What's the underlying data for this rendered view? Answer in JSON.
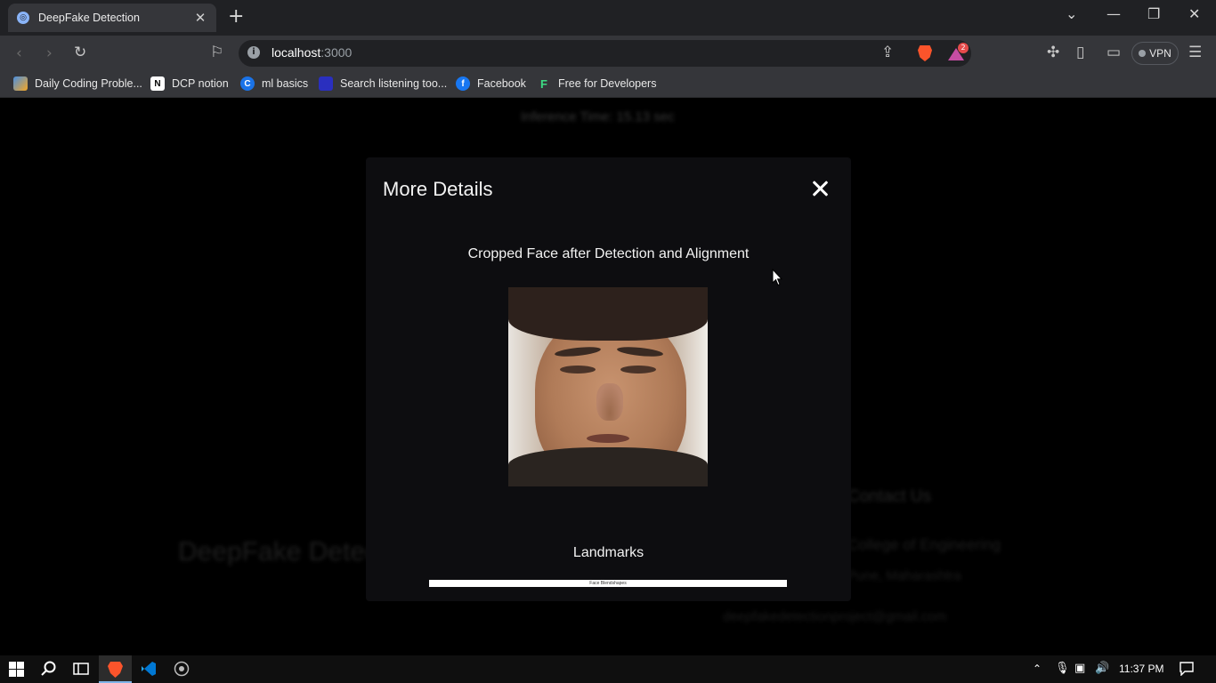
{
  "browser": {
    "tab_title": "DeepFake Detection",
    "url_host": "localhost",
    "url_port": ":3000",
    "rewards_count": "2",
    "vpn_label": "VPN",
    "bookmarks": [
      {
        "label": "Daily Coding Proble...",
        "icon": "dcp-icon"
      },
      {
        "label": "DCP notion",
        "icon": "notion-icon"
      },
      {
        "label": "ml basics",
        "icon": "c-icon"
      },
      {
        "label": "Search listening too...",
        "icon": "search-listening-icon"
      },
      {
        "label": "Facebook",
        "icon": "facebook-icon"
      },
      {
        "label": "Free for Developers",
        "icon": "f-icon"
      }
    ]
  },
  "background": {
    "inference": "Inference Time: 15.13 sec",
    "brand": "DeepFake Detection",
    "contact": "Contact Us",
    "college": "College of Engineering",
    "city": "Pune, Maharashtra",
    "email": "deepfakedetectionproject@gmail.com"
  },
  "modal": {
    "title": "More Details",
    "cropped_label": "Cropped Face after Detection and Alignment",
    "landmarks_label": "Landmarks",
    "blendshapes_chart_title": "Face Blendshapes"
  },
  "taskbar": {
    "time": "11:37 PM"
  },
  "colors": {
    "page_bg": "#000000",
    "modal_bg": "#0d0d10",
    "chrome_bg": "#35363a",
    "brave_orange": "#fb542b"
  }
}
